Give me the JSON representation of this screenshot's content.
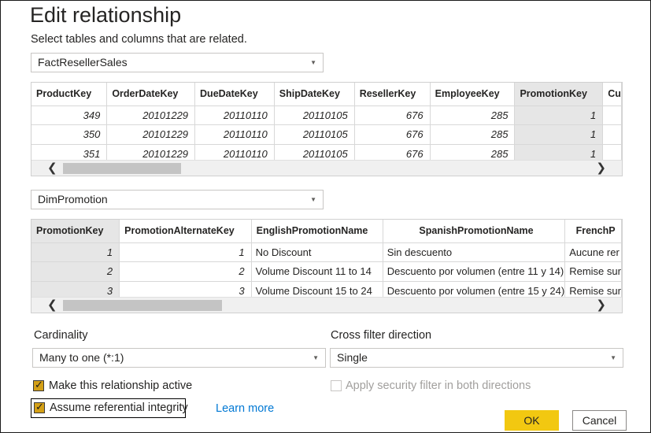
{
  "dialog": {
    "title": "Edit relationship",
    "subtitle": "Select tables and columns that are related."
  },
  "table1": {
    "selected": "FactResellerSales",
    "columns": [
      "ProductKey",
      "OrderDateKey",
      "DueDateKey",
      "ShipDateKey",
      "ResellerKey",
      "EmployeeKey",
      "PromotionKey",
      "Cu"
    ],
    "rows": [
      [
        "349",
        "20101229",
        "20110110",
        "20110105",
        "676",
        "285",
        "1",
        ""
      ],
      [
        "350",
        "20101229",
        "20110110",
        "20110105",
        "676",
        "285",
        "1",
        ""
      ],
      [
        "351",
        "20101229",
        "20110110",
        "20110105",
        "676",
        "285",
        "1",
        ""
      ]
    ],
    "selected_column": "PromotionKey"
  },
  "table2": {
    "selected": "DimPromotion",
    "columns": [
      "PromotionKey",
      "PromotionAlternateKey",
      "EnglishPromotionName",
      "SpanishPromotionName",
      "FrenchP"
    ],
    "rows": [
      [
        "1",
        "1",
        "No Discount",
        "Sin descuento",
        "Aucune rer"
      ],
      [
        "2",
        "2",
        "Volume Discount 11 to 14",
        "Descuento por volumen (entre 11 y 14)",
        "Remise sur"
      ],
      [
        "3",
        "3",
        "Volume Discount 15 to 24",
        "Descuento por volumen (entre 15 y 24)",
        "Remise sur"
      ]
    ],
    "selected_column": "PromotionKey"
  },
  "cardinality": {
    "label": "Cardinality",
    "value": "Many to one (*:1)"
  },
  "cross_filter": {
    "label": "Cross filter direction",
    "value": "Single"
  },
  "options": {
    "active_label": "Make this relationship active",
    "active_checked": true,
    "security_label": "Apply security filter in both directions",
    "security_checked": false,
    "integrity_label": "Assume referential integrity",
    "integrity_checked": true,
    "learn_more": "Learn more"
  },
  "buttons": {
    "ok": "OK",
    "cancel": "Cancel"
  },
  "icons": {
    "dropdown": "chevron-down-icon",
    "scroll_left": "chevron-left-icon",
    "scroll_right": "chevron-right-icon",
    "check": "checkmark-icon"
  },
  "colors": {
    "accent": "#f2c811",
    "checkbox": "#d4a017",
    "link": "#0078d4",
    "selected_column": "#e6e6e6"
  }
}
